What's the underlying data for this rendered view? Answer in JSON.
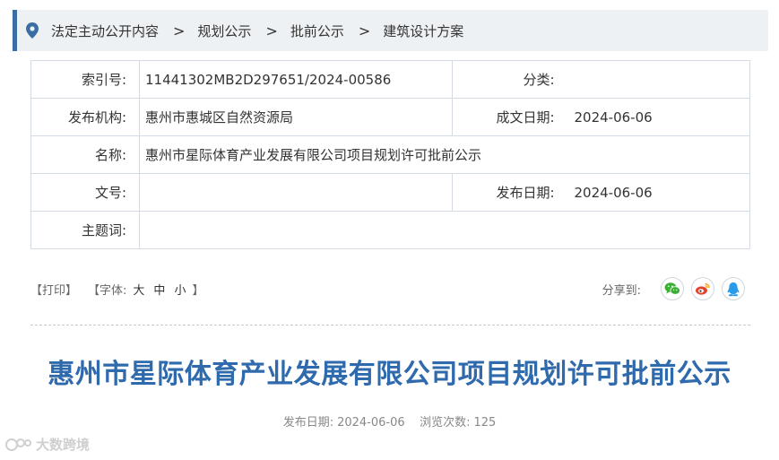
{
  "breadcrumb": {
    "icon": "location-pin-icon",
    "items": [
      "法定主动公开内容",
      "规划公示",
      "批前公示",
      "建筑设计方案"
    ],
    "separator": ">"
  },
  "meta": {
    "index_label": "索引号:",
    "index_value": "11441302MB2D297651/2024-00586",
    "category_label": "分类:",
    "category_value": "",
    "publisher_label": "发布机构:",
    "publisher_value": "惠州市惠城区自然资源局",
    "created_label": "成文日期:",
    "created_value": "2024-06-06",
    "name_label": "名称:",
    "name_value": "惠州市星际体育产业发展有限公司项目规划许可批前公示",
    "docno_label": "文号:",
    "docno_value": "",
    "published_label": "发布日期:",
    "published_value": "2024-06-06",
    "subject_label": "主题词:",
    "subject_value": ""
  },
  "toolbar": {
    "print": "【打印】",
    "font_prefix": "【字体:",
    "font_large": "大",
    "font_medium": "中",
    "font_small": "小",
    "font_suffix": "】",
    "share_label": "分享到:",
    "share_icons": [
      "wechat-icon",
      "weibo-icon",
      "qq-icon"
    ],
    "share_colors": {
      "wechat": "#3cb034",
      "weibo": "#e2452f",
      "qq": "#2a9be8"
    }
  },
  "article": {
    "title": "惠州市星际体育产业发展有限公司项目规划许可批前公示",
    "date_label": "发布日期:",
    "date_value": "2024-06-06",
    "views_label": "浏览次数:",
    "views_value": "125"
  },
  "watermark": {
    "text": "大数跨境"
  },
  "colors": {
    "accent": "#3a6da3",
    "title": "#2f6aad",
    "breadcrumb_bg": "#eef1f4",
    "border": "#d4dbe3"
  }
}
